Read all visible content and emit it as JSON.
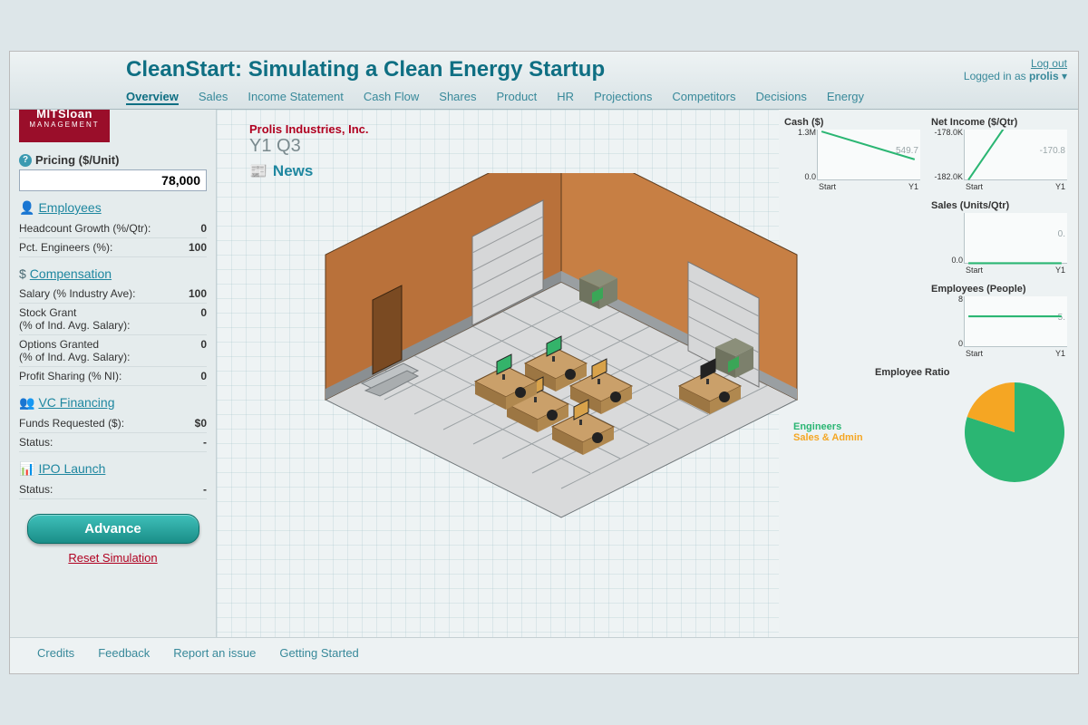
{
  "brand": {
    "line1": "MITSloan",
    "line2": "MANAGEMENT"
  },
  "header": {
    "title": "CleanStart: Simulating a Clean Energy Startup",
    "logout": "Log out",
    "logged_in_prefix": "Logged in as ",
    "user": "prolis",
    "nav": [
      "Overview",
      "Sales",
      "Income Statement",
      "Cash Flow",
      "Shares",
      "Product",
      "HR",
      "Projections",
      "Competitors",
      "Decisions",
      "Energy"
    ],
    "active_nav": "Overview"
  },
  "sidebar": {
    "pricing": {
      "label": "Pricing ($/Unit)",
      "value": "78,000"
    },
    "employees": {
      "title": "Employees",
      "rows": [
        {
          "label": "Headcount Growth (%/Qtr):",
          "value": "0"
        },
        {
          "label": "Pct. Engineers (%):",
          "value": "100"
        }
      ]
    },
    "compensation": {
      "title": "Compensation",
      "rows": [
        {
          "label": "Salary (% Industry Ave):",
          "value": "100"
        },
        {
          "label": "Stock Grant\n(% of Ind. Avg. Salary):",
          "value": "0"
        },
        {
          "label": "Options Granted\n(% of Ind. Avg. Salary):",
          "value": "0"
        },
        {
          "label": "Profit Sharing (% NI):",
          "value": "0"
        }
      ]
    },
    "vc": {
      "title": "VC Financing",
      "rows": [
        {
          "label": "Funds Requested ($):",
          "value": "$0"
        },
        {
          "label": "Status:",
          "value": "-"
        }
      ]
    },
    "ipo": {
      "title": "IPO Launch",
      "rows": [
        {
          "label": "Status:",
          "value": "-"
        }
      ]
    },
    "advance": "Advance",
    "reset": "Reset Simulation"
  },
  "main": {
    "company": "Prolis Industries, Inc.",
    "period": "Y1 Q3",
    "news": "News"
  },
  "footer": [
    "Credits",
    "Feedback",
    "Report an issue",
    "Getting Started"
  ],
  "chart_data": [
    {
      "id": "cash",
      "title": "Cash ($)",
      "type": "line",
      "x": [
        "Start",
        "Y1"
      ],
      "values": [
        1300000,
        549700
      ],
      "ylim": [
        0,
        1300000
      ],
      "yticklabels": [
        "1.3M",
        "0.0"
      ],
      "end_label": "549.7"
    },
    {
      "id": "netincome",
      "title": "Net Income ($/Qtr)",
      "type": "line",
      "x": [
        "Start",
        "Y1"
      ],
      "values": [
        -182000,
        -170800
      ],
      "ylim": [
        -182000,
        -178000
      ],
      "yticklabels": [
        "-178.0K",
        "-182.0K"
      ],
      "end_label": "-170.8"
    },
    {
      "id": "sales",
      "title": "Sales (Units/Qtr)",
      "type": "line",
      "x": [
        "Start",
        "Y1"
      ],
      "values": [
        0,
        0
      ],
      "ylim": [
        0,
        1
      ],
      "yticklabels": [
        "",
        "0.0"
      ],
      "end_label": "0."
    },
    {
      "id": "employees",
      "title": "Employees (People)",
      "type": "line",
      "x": [
        "Start",
        "Y1"
      ],
      "values": [
        5,
        5
      ],
      "ylim": [
        0,
        8
      ],
      "yticklabels": [
        "8",
        "0"
      ],
      "end_label": "5."
    },
    {
      "id": "ratio",
      "title": "Employee Ratio",
      "type": "pie",
      "series": [
        {
          "name": "Engineers",
          "value": 80,
          "color": "#2bb673"
        },
        {
          "name": "Sales & Admin",
          "value": 20,
          "color": "#f5a623"
        }
      ]
    }
  ]
}
